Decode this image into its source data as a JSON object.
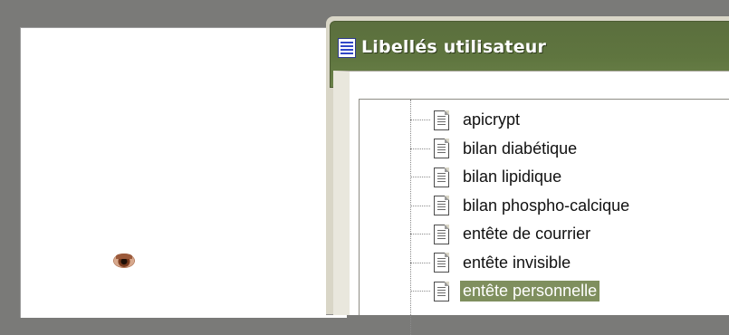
{
  "dialog": {
    "title": "Libellés utilisateur",
    "title_icon": "document-list-icon"
  },
  "tree": {
    "items": [
      {
        "label": "apicrypt",
        "icon": "document-icon",
        "selected": false
      },
      {
        "label": "bilan diabétique",
        "icon": "document-icon",
        "selected": false
      },
      {
        "label": "bilan lipidique",
        "icon": "document-icon",
        "selected": false
      },
      {
        "label": "bilan phospho-calcique",
        "icon": "document-icon",
        "selected": false
      },
      {
        "label": "entête de courrier",
        "icon": "document-icon",
        "selected": false
      },
      {
        "label": "entête invisible",
        "icon": "document-icon",
        "selected": false
      },
      {
        "label": "entête personnelle",
        "icon": "document-icon",
        "selected": true
      }
    ]
  },
  "colors": {
    "titlebar": "#5f753f",
    "selection": "#7f8f5e",
    "desktop": "#7a7a78"
  }
}
